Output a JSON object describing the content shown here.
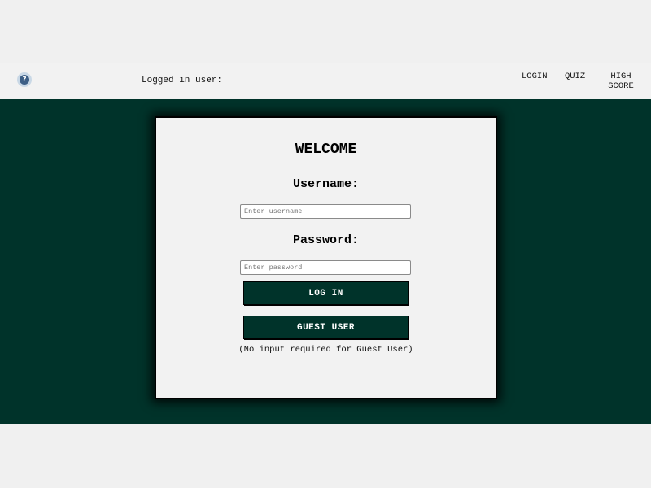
{
  "navbar": {
    "help_icon": "question-mark-icon",
    "logged_in_label": "Logged in user:",
    "links": {
      "login": "LOGIN",
      "quiz": "QUIZ",
      "high_score_line1": "HIGH",
      "high_score_line2": "SCORE"
    }
  },
  "login_card": {
    "title": "WELCOME",
    "username_label": "Username:",
    "username_placeholder": "Enter username",
    "username_value": "",
    "password_label": "Password:",
    "password_placeholder": "Enter password",
    "password_value": "",
    "login_button": "LOG IN",
    "guest_button": "GUEST USER",
    "guest_note": "(No input required for Guest User)"
  },
  "colors": {
    "accent_dark_green": "#00332a",
    "page_background": "#f0f0f0",
    "card_background": "#f2f2f2"
  }
}
